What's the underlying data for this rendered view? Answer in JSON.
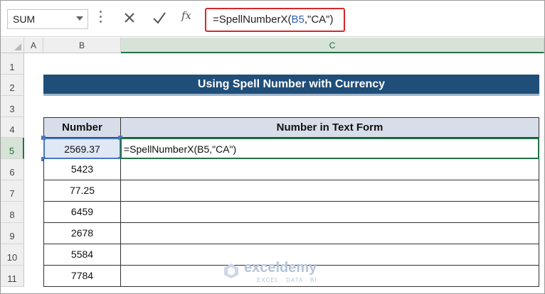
{
  "formula_bar": {
    "name_box": "SUM",
    "fx_label": "fx",
    "formula_prefix": "=SpellNumberX(",
    "formula_ref": "B5",
    "formula_suffix": ",\"CA\")"
  },
  "columns": [
    "A",
    "B",
    "C"
  ],
  "rows": [
    "1",
    "2",
    "3",
    "4",
    "5",
    "6",
    "7",
    "8",
    "9",
    "10",
    "11"
  ],
  "title": "Using Spell Number with Currency",
  "table": {
    "headers": [
      "Number",
      "Number in Text Form"
    ],
    "numbers": [
      "2569.37",
      "5423",
      "77.25",
      "6459",
      "2678",
      "5584",
      "7784"
    ],
    "editing_formula": "=SpellNumberX(B5,\"CA\")"
  },
  "watermark": {
    "name": "exceldemy",
    "tagline": "EXCEL · DATA · BI"
  },
  "colors": {
    "title_bg": "#1f4e79",
    "header_fill": "#d8dee9",
    "active_green": "#217346",
    "formula_outline": "#d62828"
  }
}
